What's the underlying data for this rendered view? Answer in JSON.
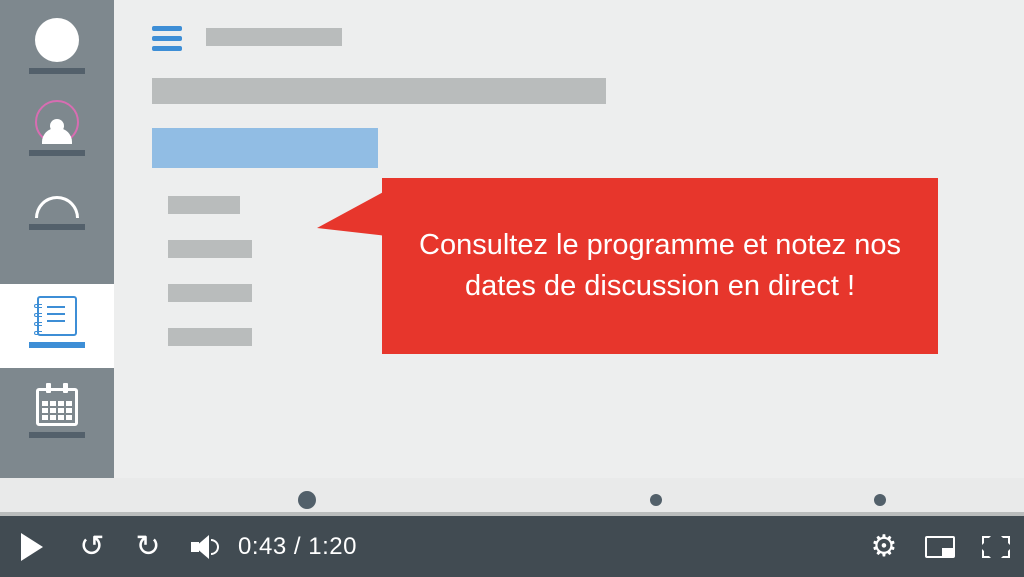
{
  "callout": {
    "message": "Consultez le programme et notez nos dates de discussion en direct !"
  },
  "player": {
    "current_time": "0:43",
    "duration": "1:20",
    "separator": " / "
  },
  "sidebar": {
    "items": [
      "home",
      "profile",
      "food",
      "agenda",
      "calendar"
    ],
    "active": "agenda"
  }
}
